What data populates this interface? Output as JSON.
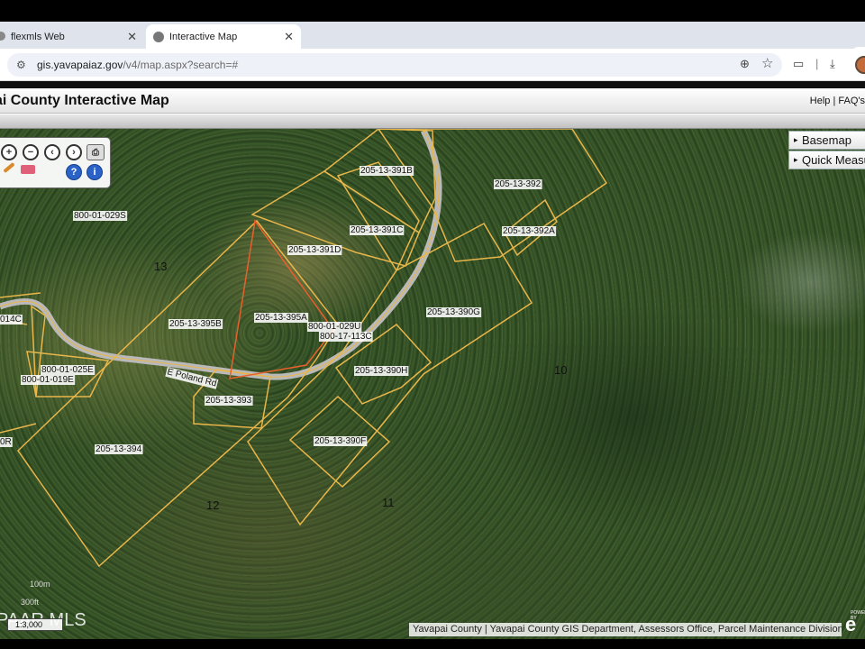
{
  "browser": {
    "tabs": [
      {
        "title": "flexmls Web"
      },
      {
        "title": "Interactive Map"
      }
    ],
    "new_tab": "+",
    "url_domain": "gis.yavapaiaz.gov",
    "url_path": "/v4/map.aspx?search=#"
  },
  "header": {
    "title": "ai County Interactive Map",
    "help": "Help",
    "sep": "|",
    "faqs": "FAQ's"
  },
  "map": {
    "basemap_button": "Basemap",
    "quick_measure_button": "Quick Measu",
    "parcels": [
      "205-13-391B",
      "205-13-392",
      "800-01-029S",
      "205-13-391C",
      "205-13-392A",
      "205-13-391D",
      "205-13-395A",
      "205-13-395B",
      "800-01-029U",
      "800-17-113C",
      "205-13-390G",
      "800-01-025E",
      "800-01-019E",
      "205-13-390H",
      "205-13-393",
      "205-13-390F",
      "205-13-394",
      "014C",
      "0R"
    ],
    "road": "E Poland Rd",
    "sections": [
      "13",
      "10",
      "12",
      "11"
    ],
    "scale_100": "100m",
    "scale_300": "300ft",
    "scale_ratio": "1:3,000",
    "watermark": "PAAR MLS",
    "attribution": "Yavapai County | Yavapai County GIS Department, Assessors Office, Parcel Maintenance Division | ...",
    "esri_powered": "POWERED BY",
    "esri": "e"
  },
  "colors": {
    "parcel_line": "#e8b64a",
    "selected_parcel": "#e8602c"
  }
}
